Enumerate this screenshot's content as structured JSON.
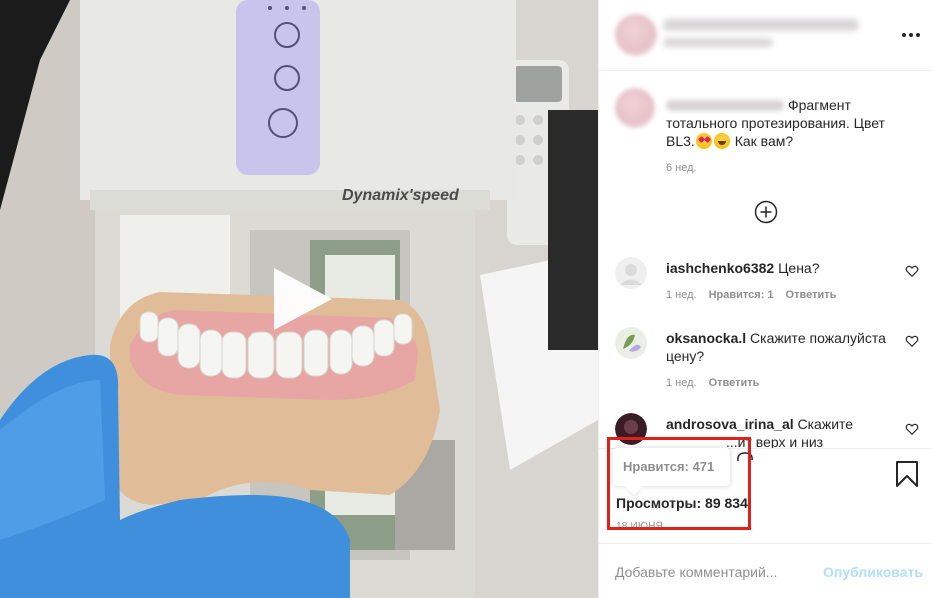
{
  "post": {
    "caption_text": "Фрагмент тотального протезирования. Цвет BL3.",
    "caption_tail": "Как вам?",
    "caption_time": "6 нед.",
    "emojis": [
      "heart-eyes-emoji",
      "grinning-emoji"
    ]
  },
  "comments": [
    {
      "user": "iashchenko6382",
      "text": "Цена?",
      "time": "1 нед.",
      "likes": "Нравится: 1",
      "reply": "Ответить"
    },
    {
      "user": "oksanocka.l",
      "text": "Скажите пожалуйста цену?",
      "time": "1 нед.",
      "reply": "Ответить"
    },
    {
      "user": "androsova_irina_al",
      "text": "Скажите",
      "text_partial": "...ит верх и низ"
    }
  ],
  "tooltip": {
    "likes_label": "Нравится: 471"
  },
  "stats": {
    "views_label": "Просмотры: 89 834",
    "date": "18 июня"
  },
  "add_comment": {
    "placeholder": "Добавьте комментарий...",
    "publish_label": "Опубликовать"
  },
  "colors": {
    "accent_disabled": "#b2dffc",
    "highlight": "#e0201a",
    "secondary_text": "#8e8e8e"
  },
  "icons": [
    "more-icon",
    "add-circle-icon",
    "heart-icon",
    "bookmark-icon",
    "play-icon",
    "comment-icon"
  ]
}
